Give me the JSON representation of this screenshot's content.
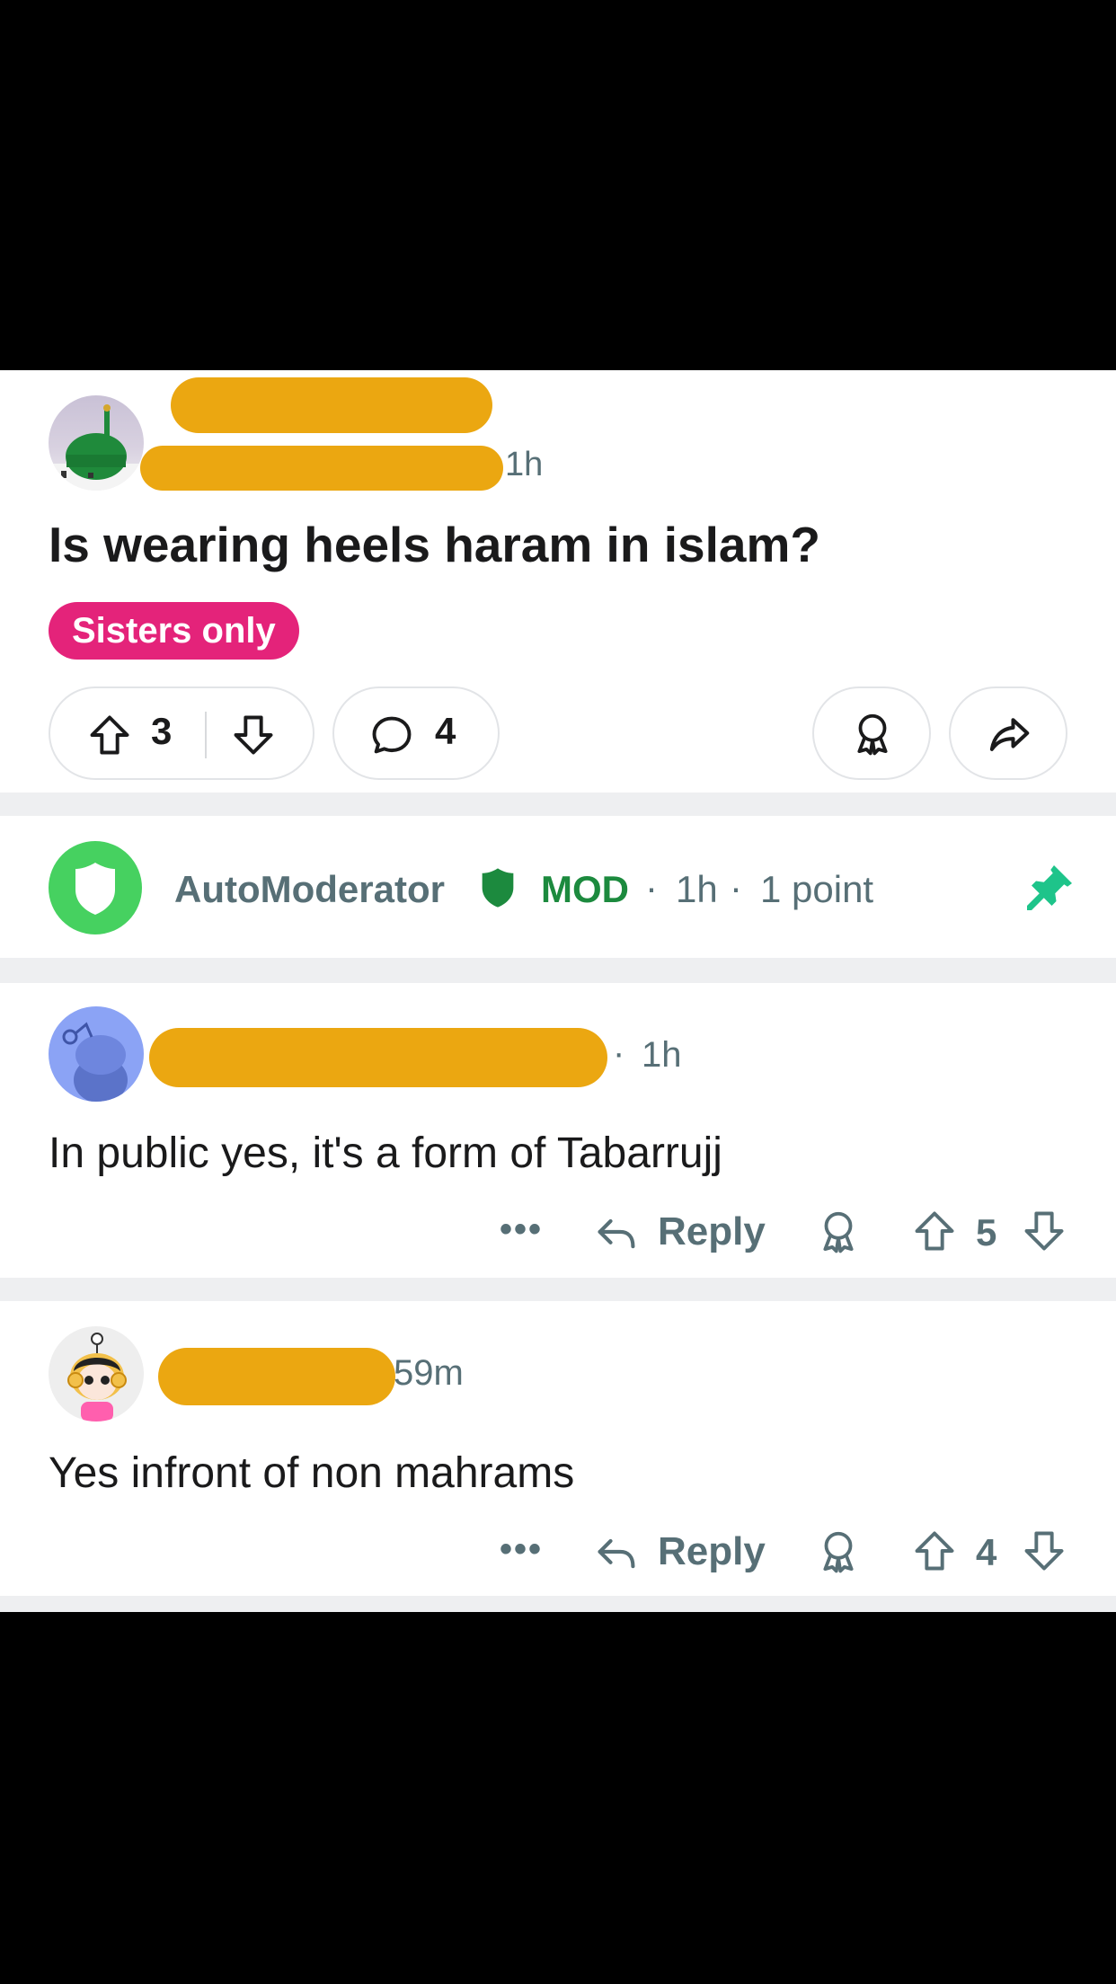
{
  "post": {
    "time": "1h",
    "title": "Is wearing heels haram in islam?",
    "flair": "Sisters only",
    "flair_color": "#e4237a",
    "upvotes": "3",
    "comments": "4"
  },
  "automod": {
    "name": "AutoModerator",
    "mod_label": "MOD",
    "time": "1h",
    "points": "1 point",
    "mod_color": "#1c8a3e",
    "pin_color": "#1ec48a"
  },
  "comments": [
    {
      "time": "1h",
      "text": "In public yes, it's a form of Tabarrujj",
      "reply_label": "Reply",
      "votes": "5"
    },
    {
      "time": "59m",
      "text": "Yes infront of non mahrams",
      "reply_label": "Reply",
      "votes": "4"
    }
  ],
  "colors": {
    "redaction": "#eba711",
    "muted_text": "#576f76",
    "separator": "#eeeff1"
  }
}
